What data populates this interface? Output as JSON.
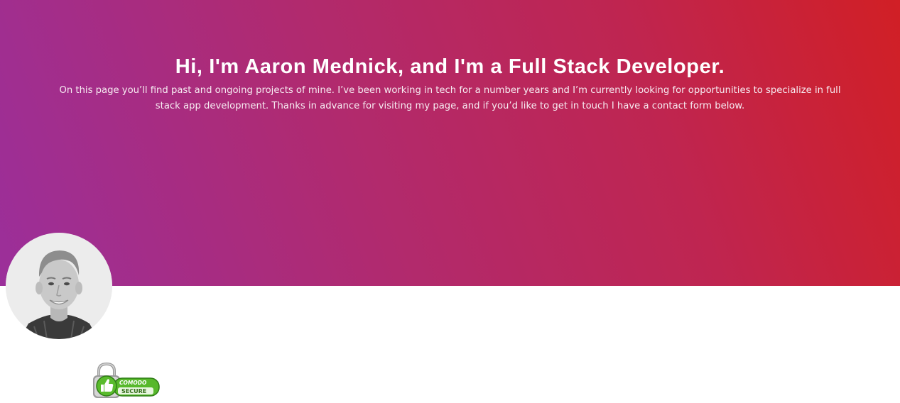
{
  "hero": {
    "title": "Hi, I'm Aaron Mednick, and I'm a Full Stack Developer.",
    "intro": "On this page you’ll find past and ongoing projects of mine. I’ve been working in tech for a number years and I’m currently looking for opportunities to specialize in full stack app development. Thanks in advance for visiting my page, and if you’d like to get in touch I have a contact form below."
  },
  "badge": {
    "brand": "COMODO",
    "label": "SECURE"
  },
  "colors": {
    "gradient_start": "#9b2f9a",
    "gradient_end": "#d11f25",
    "badge_green": "#57b82b"
  },
  "icons": {
    "avatar": "profile-photo",
    "badge_lock": "padlock-icon",
    "badge_thumb": "thumbs-up-icon"
  }
}
